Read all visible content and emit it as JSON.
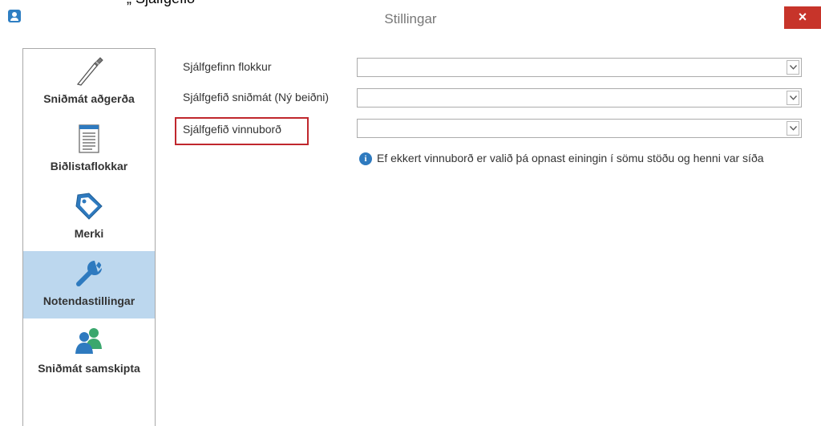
{
  "window": {
    "title": "Stillingar",
    "close_label": "×"
  },
  "top_crop_text": "„ Sjálfgefið",
  "sidebar": {
    "items": [
      {
        "label": "Sniðmát aðgerða",
        "icon": "scalpel-icon",
        "active": false
      },
      {
        "label": "Biðlistaflokkar",
        "icon": "document-list-icon",
        "active": false
      },
      {
        "label": "Merki",
        "icon": "tag-icon",
        "active": false
      },
      {
        "label": "Notendastillingar",
        "icon": "wrench-icon",
        "active": true
      },
      {
        "label": "Sniðmát samskipta",
        "icon": "users-icon",
        "active": false
      }
    ]
  },
  "form": {
    "fields": [
      {
        "label": "Sjálfgefinn flokkur",
        "value": ""
      },
      {
        "label": "Sjálfgefið sniðmát (Ný beiðni)",
        "value": ""
      },
      {
        "label": "Sjálfgefið vinnuborð",
        "value": "",
        "highlighted": true
      }
    ],
    "info_text": "Ef ekkert vinnuborð er valið þá opnast einingin í sömu stöðu og henni var síða"
  },
  "colors": {
    "accent_blue": "#2e7abf",
    "active_nav_bg": "#bcd7ee",
    "close_red": "#c7342a",
    "highlight_red": "#c0272d",
    "users_green": "#3aa76d"
  }
}
